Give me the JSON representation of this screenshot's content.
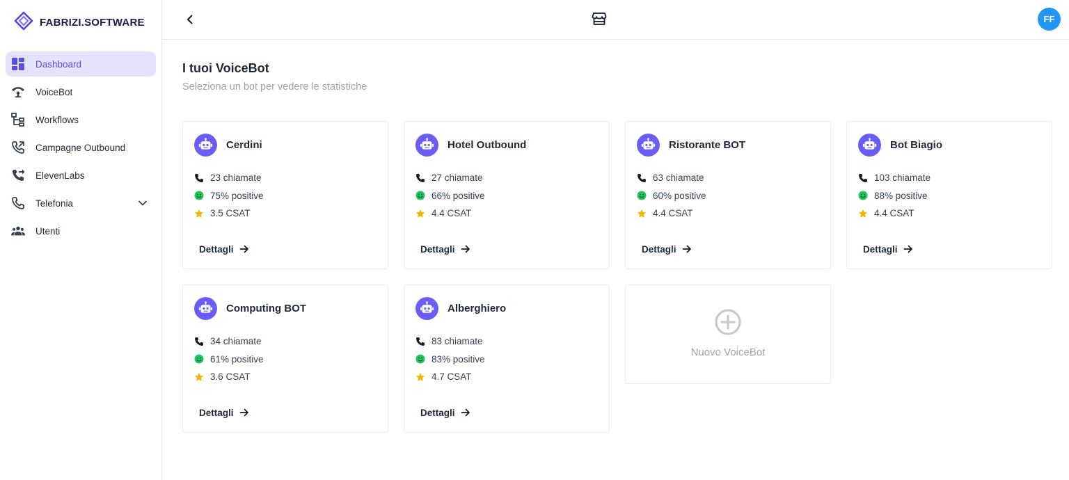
{
  "brand": {
    "name": "FABRIZI.SOFTWARE",
    "accent": "#5b4ee6"
  },
  "sidebar": {
    "items": [
      {
        "label": "Dashboard",
        "icon": "dashboard-icon",
        "active": true
      },
      {
        "label": "VoiceBot",
        "icon": "voicebot-icon"
      },
      {
        "label": "Workflows",
        "icon": "workflow-icon"
      },
      {
        "label": "Campagne Outbound",
        "icon": "phone-outgoing-icon"
      },
      {
        "label": "ElevenLabs",
        "icon": "phone-forward-icon"
      },
      {
        "label": "Telefonia",
        "icon": "phone-icon",
        "expandable": true
      },
      {
        "label": "Utenti",
        "icon": "users-icon"
      }
    ]
  },
  "header": {
    "avatar_initials": "FF",
    "avatar_color": "#2196f3"
  },
  "main": {
    "title": "I tuoi VoiceBot",
    "subtitle": "Seleziona un bot per vedere le statistiche",
    "details_label": "Dettagli",
    "new_bot_label": "Nuovo VoiceBot",
    "bots": [
      {
        "name": "Cerdini",
        "calls": "23 chiamate",
        "positive": "75% positive",
        "csat": "3.5 CSAT"
      },
      {
        "name": "Hotel Outbound",
        "calls": "27 chiamate",
        "positive": "66% positive",
        "csat": "4.4 CSAT"
      },
      {
        "name": "Ristorante BOT",
        "calls": "63 chiamate",
        "positive": "60% positive",
        "csat": "4.4 CSAT"
      },
      {
        "name": "Bot Biagio",
        "calls": "103 chiamate",
        "positive": "88% positive",
        "csat": "4.4 CSAT"
      },
      {
        "name": "Computing BOT",
        "calls": "34 chiamate",
        "positive": "61% positive",
        "csat": "3.6 CSAT"
      },
      {
        "name": "Alberghiero",
        "calls": "83 chiamate",
        "positive": "83% positive",
        "csat": "4.7 CSAT"
      }
    ]
  },
  "colors": {
    "bot_avatar": "#6b5cf6",
    "positive": "#22c55e",
    "star": "#f5b400"
  }
}
